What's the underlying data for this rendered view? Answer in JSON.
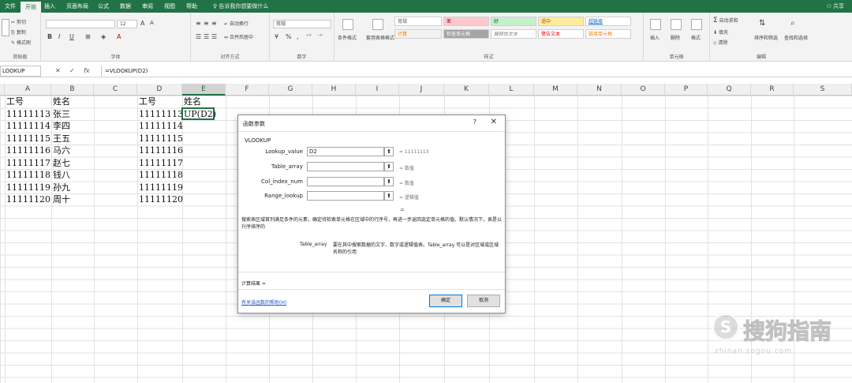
{
  "ribbon_tabs": [
    "文件",
    "开始",
    "插入",
    "页面布局",
    "公式",
    "数据",
    "审阅",
    "视图",
    "帮助"
  ],
  "tell_me": "告诉我你想要做什么",
  "share": "共享",
  "clipboard": {
    "cut": "剪切",
    "copy": "复制",
    "format_painter": "格式刷",
    "label": "剪贴板"
  },
  "font": {
    "size": "12",
    "label": "字体"
  },
  "alignment": {
    "wrap": "自动换行",
    "merge": "合并后居中",
    "label": "对齐方式"
  },
  "number": {
    "format": "常规",
    "label": "数字"
  },
  "styles": {
    "conditional": "条件格式",
    "table": "套用表格格式",
    "cells": [
      "常规",
      "差",
      "好",
      "适中",
      "超链接",
      "计算",
      "检查单元格",
      "解释性文本",
      "警告文本",
      "链接单元格"
    ],
    "label": "样式"
  },
  "cells_group": {
    "insert": "插入",
    "delete": "删除",
    "format": "格式",
    "label": "单元格"
  },
  "editing": {
    "autosum": "自动求和",
    "fill": "填充",
    "clear": "清除",
    "sort": "排序和筛选",
    "find": "查找和选择",
    "label": "编辑"
  },
  "formula_bar": {
    "name_box": "LOOKUP",
    "formula": "=VLOOKUP(D2)"
  },
  "columns": [
    "A",
    "B",
    "C",
    "D",
    "E",
    "F",
    "G",
    "H",
    "I",
    "J",
    "K",
    "L",
    "M",
    "N",
    "O",
    "P",
    "Q",
    "R",
    "S"
  ],
  "sheet": {
    "headers": {
      "a": "工号",
      "b": "姓名",
      "d": "工号",
      "e": "姓名"
    },
    "rows": [
      {
        "id": "11111113",
        "name": "张三",
        "id2": "11111113"
      },
      {
        "id": "11111114",
        "name": "李四",
        "id2": "11111114"
      },
      {
        "id": "11111115",
        "name": "王五",
        "id2": "11111115"
      },
      {
        "id": "11111116",
        "name": "马六",
        "id2": "11111116"
      },
      {
        "id": "11111117",
        "name": "赵七",
        "id2": "11111117"
      },
      {
        "id": "11111118",
        "name": "钱八",
        "id2": "11111118"
      },
      {
        "id": "11111119",
        "name": "孙九",
        "id2": "11111119"
      },
      {
        "id": "11111120",
        "name": "周十",
        "id2": "11111120"
      }
    ],
    "active_cell_text": "UP(D2)"
  },
  "dialog": {
    "title": "函数参数",
    "help": "?",
    "close": "✕",
    "function_name": "VLOOKUP",
    "args": [
      {
        "label": "Lookup_value",
        "value": "D2",
        "result": "= 11111113"
      },
      {
        "label": "Table_array",
        "value": "",
        "result": "= 数值"
      },
      {
        "label": "Col_index_num",
        "value": "",
        "result": "= 数值"
      },
      {
        "label": "Range_lookup",
        "value": "",
        "result": "= 逻辑值"
      }
    ],
    "middle": "=",
    "description": "搜索表区域首列满足条件的元素，确定待检索单元格在区域中的行序号，再进一步返回选定单元格的值。默认情况下，表是以升序排序的",
    "arg_label": "Table_array",
    "arg_description": "要在其中搜索数据的文字、数字或逻辑值表。Table_array 可以是对区域或区域名称的引用",
    "result_label": "计算结果 =",
    "help_link": "有关该函数的帮助(H)",
    "ok": "确定",
    "cancel": "取消"
  },
  "watermark": {
    "icon": "S",
    "text": "搜狗指南",
    "sub": "zhinan.sogou.com"
  }
}
